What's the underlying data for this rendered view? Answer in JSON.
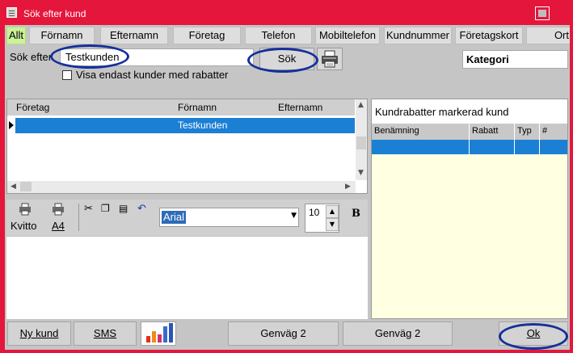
{
  "window": {
    "title": "Sök efter kund"
  },
  "tabs": [
    {
      "label": "Allt",
      "active": true
    },
    {
      "label": "Förnamn"
    },
    {
      "label": "Efternamn"
    },
    {
      "label": "Företag"
    },
    {
      "label": "Telefon"
    },
    {
      "label": "Mobiltelefon"
    },
    {
      "label": "Kundnummer"
    },
    {
      "label": "Företagskort"
    },
    {
      "label": "Ort"
    }
  ],
  "search": {
    "label": "Sök efter",
    "value": "Testkunden",
    "button_label": "Sök",
    "print_icon": "printer-icon",
    "kategori_label": "Kategori",
    "filter_checkbox_label": "Visa endast kunder med rabatter"
  },
  "customer_grid": {
    "columns": [
      "Företag",
      "Förnamn",
      "Efternamn"
    ],
    "rows": [
      {
        "foretag": "",
        "fornamn": "Testkunden",
        "efternamn": ""
      }
    ]
  },
  "editor_toolbar": {
    "receipt_label": "Kvitto",
    "a4_label": "A4",
    "font": "Arial",
    "font_size": "10",
    "bold_label": "B"
  },
  "discounts": {
    "title": "Kundrabatter markerad kund",
    "columns": [
      "Benämning",
      "Rabatt",
      "Typ",
      "#"
    ]
  },
  "bottom": {
    "new_customer": "Ny kund",
    "sms": "SMS",
    "shortcut1": "Genväg 2",
    "shortcut2": "Genväg 2",
    "ok": "Ok"
  },
  "colors": {
    "frame": "#e5163b",
    "selection": "#1b7fd4",
    "active_tab": "#c9f29a",
    "highlight_ellipse": "#14309a"
  }
}
